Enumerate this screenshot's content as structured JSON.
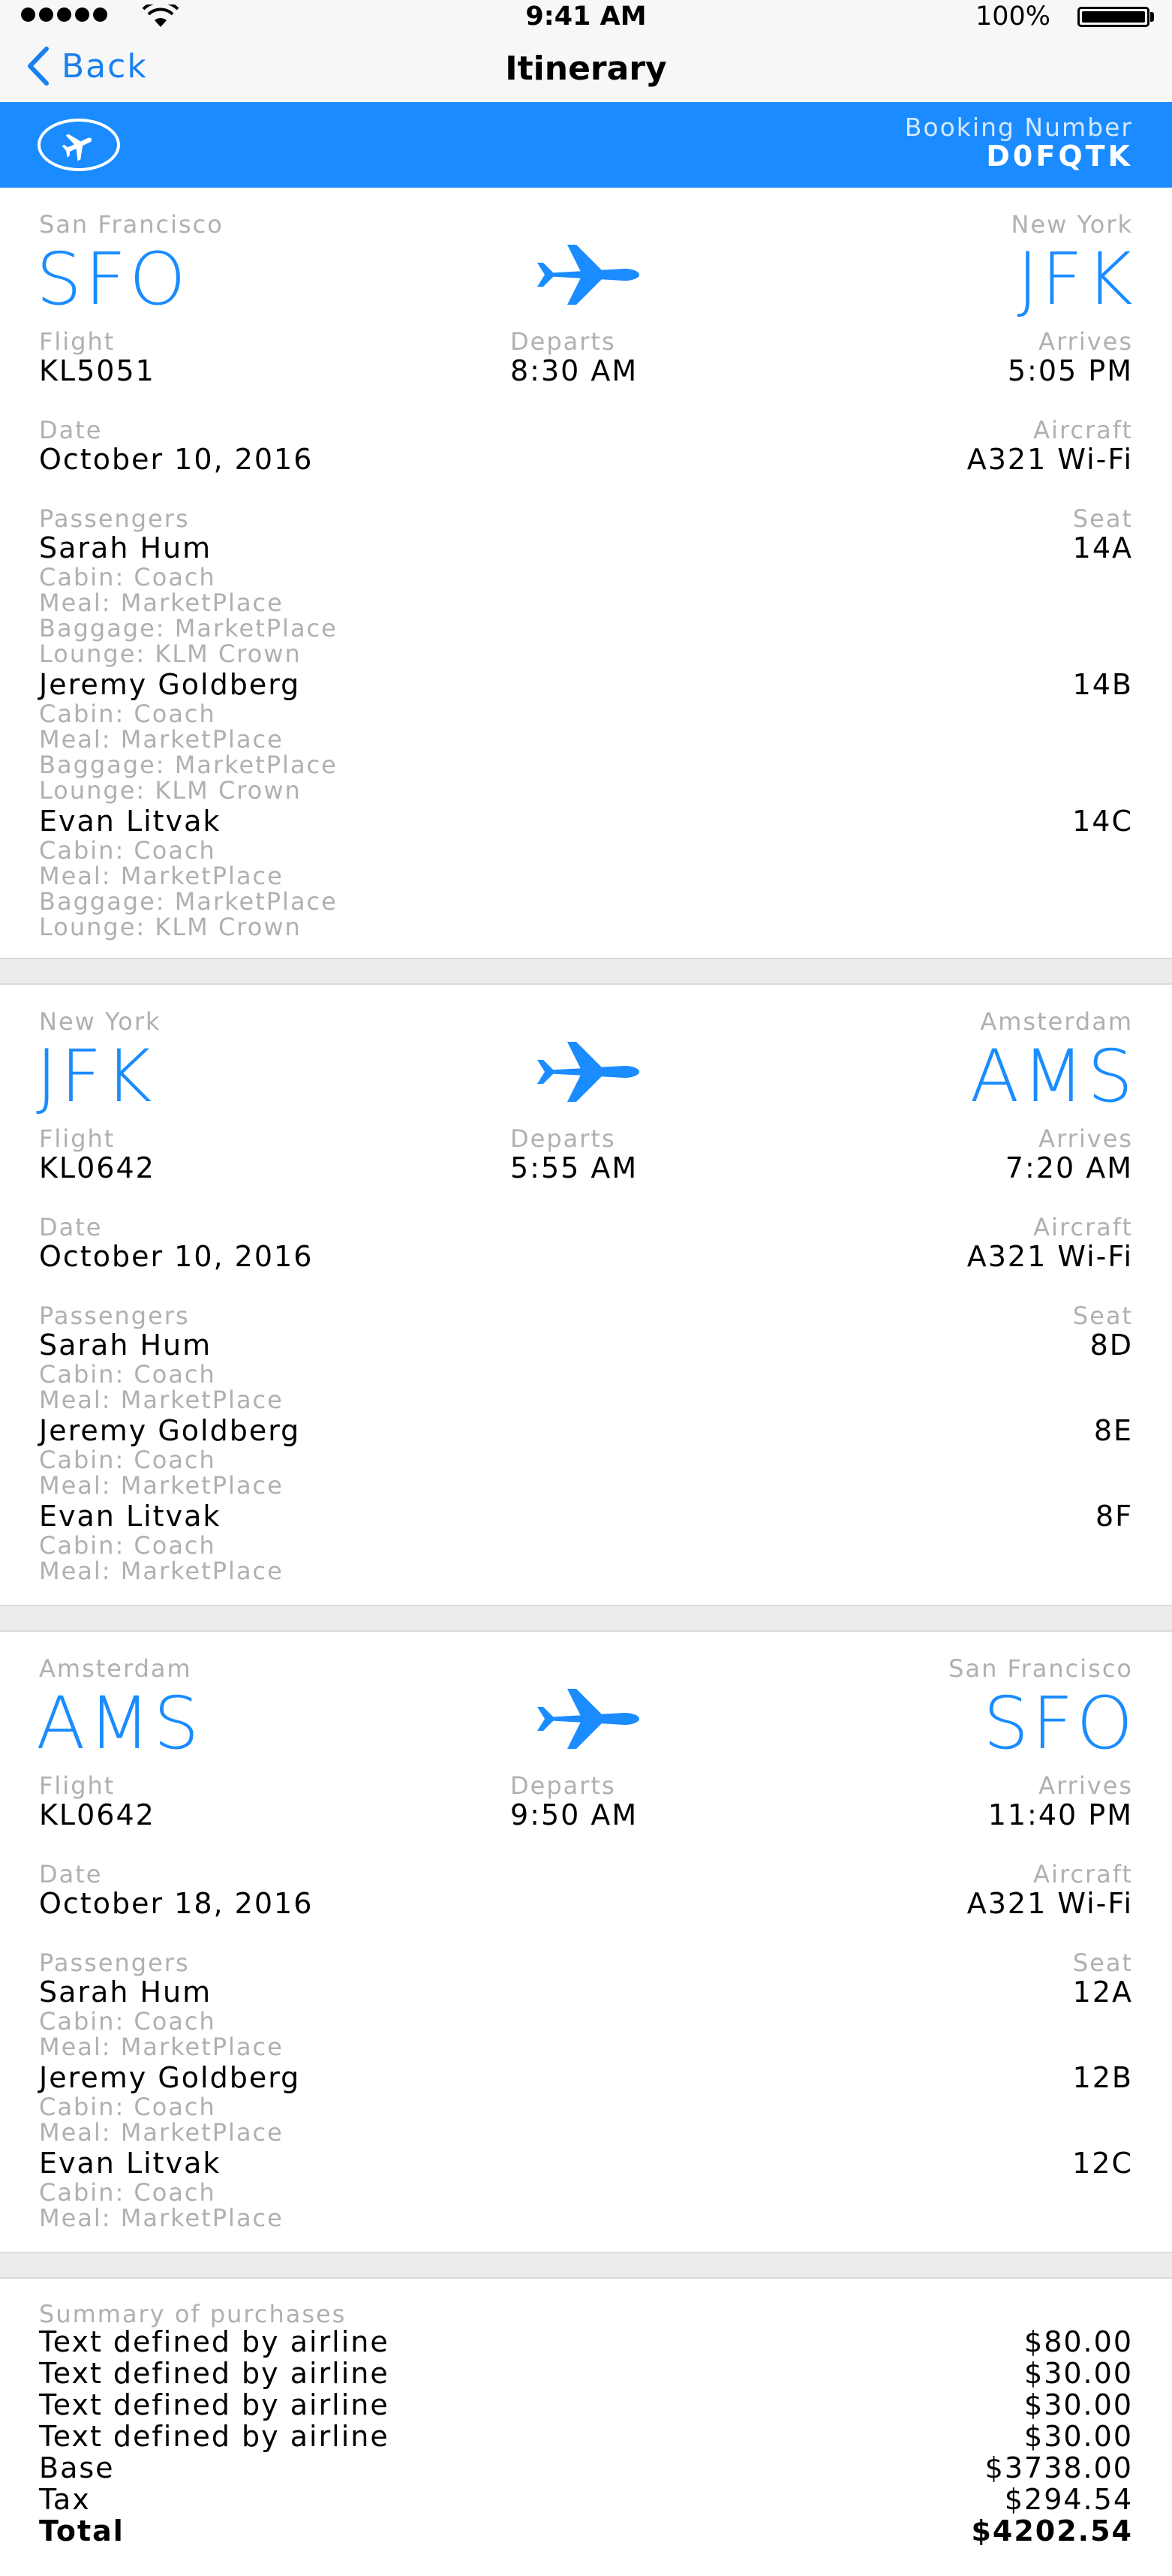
{
  "status_bar": {
    "time": "9:41 AM",
    "battery": "100%"
  },
  "nav": {
    "back_label": "Back",
    "title": "Itinerary"
  },
  "booking": {
    "label": "Booking Number",
    "number": "D0FQTK"
  },
  "labels": {
    "flight": "Flight",
    "departs": "Departs",
    "arrives": "Arrives",
    "date": "Date",
    "aircraft": "Aircraft",
    "passengers": "Passengers",
    "seat": "Seat"
  },
  "segments": [
    {
      "from_city": "San Francisco",
      "from_code": "SFO",
      "to_city": "New York",
      "to_code": "JFK",
      "flight": "KL5051",
      "departs": "8:30 AM",
      "arrives": "5:05 PM",
      "date": "October 10, 2016",
      "aircraft": "A321 Wi-Fi",
      "passengers": [
        {
          "name": "Sarah Hum",
          "seat": "14A",
          "cabin": "Cabin: Coach",
          "meal": "Meal: MarketPlace",
          "baggage": "Baggage: MarketPlace",
          "lounge": "Lounge: KLM Crown"
        },
        {
          "name": "Jeremy Goldberg",
          "seat": "14B",
          "cabin": "Cabin: Coach",
          "meal": "Meal: MarketPlace",
          "baggage": "Baggage: MarketPlace",
          "lounge": "Lounge: KLM Crown"
        },
        {
          "name": "Evan Litvak",
          "seat": "14C",
          "cabin": "Cabin: Coach",
          "meal": "Meal: MarketPlace",
          "baggage": "Baggage: MarketPlace",
          "lounge": "Lounge: KLM Crown"
        }
      ]
    },
    {
      "from_city": "New York",
      "from_code": "JFK",
      "to_city": "Amsterdam",
      "to_code": "AMS",
      "flight": "KL0642",
      "departs": "5:55 AM",
      "arrives": "7:20 AM",
      "date": "October 10, 2016",
      "aircraft": "A321 Wi-Fi",
      "passengers": [
        {
          "name": "Sarah Hum",
          "seat": "8D",
          "cabin": "Cabin: Coach",
          "meal": "Meal: MarketPlace"
        },
        {
          "name": "Jeremy Goldberg",
          "seat": "8E",
          "cabin": "Cabin: Coach",
          "meal": "Meal: MarketPlace"
        },
        {
          "name": "Evan Litvak",
          "seat": "8F",
          "cabin": "Cabin: Coach",
          "meal": "Meal: MarketPlace"
        }
      ]
    },
    {
      "from_city": "Amsterdam",
      "from_code": "AMS",
      "to_city": "San Francisco",
      "to_code": "SFO",
      "flight": "KL0642",
      "departs": "9:50 AM",
      "arrives": "11:40 PM",
      "date": "October 18, 2016",
      "aircraft": "A321 Wi-Fi",
      "passengers": [
        {
          "name": "Sarah Hum",
          "seat": "12A",
          "cabin": "Cabin: Coach",
          "meal": "Meal: MarketPlace"
        },
        {
          "name": "Jeremy Goldberg",
          "seat": "12B",
          "cabin": "Cabin: Coach",
          "meal": "Meal: MarketPlace"
        },
        {
          "name": "Evan Litvak",
          "seat": "12C",
          "cabin": "Cabin: Coach",
          "meal": "Meal: MarketPlace"
        }
      ]
    }
  ],
  "summary": {
    "title": "Summary of purchases",
    "rows": [
      {
        "label": "Text defined by airline",
        "amount": "$80.00"
      },
      {
        "label": "Text defined by airline",
        "amount": "$30.00"
      },
      {
        "label": "Text defined by airline",
        "amount": "$30.00"
      },
      {
        "label": "Text defined by airline",
        "amount": "$30.00"
      },
      {
        "label": "Base",
        "amount": "$3738.00"
      },
      {
        "label": "Tax",
        "amount": "$294.54"
      },
      {
        "label": "Total",
        "amount": "$4202.54"
      }
    ]
  },
  "colors": {
    "accent": "#1a8cff",
    "link": "#1a80f0",
    "muted": "#b0b0b0"
  }
}
